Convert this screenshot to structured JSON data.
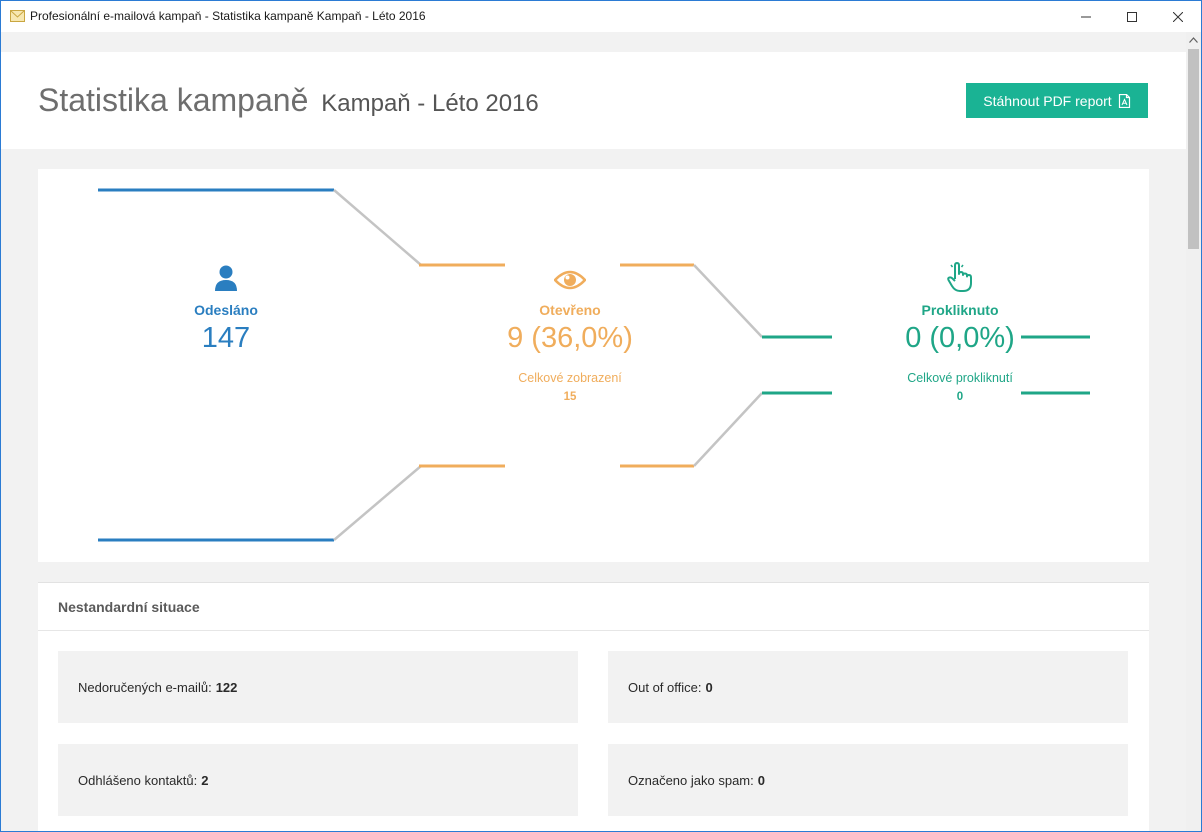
{
  "window": {
    "title": "Profesionální e-mailová kampaň - Statistika kampaně Kampaň - Léto 2016"
  },
  "header": {
    "title": "Statistika kampaně",
    "campaign_name": "Kampaň - Léto 2016",
    "pdf_button_label": "Stáhnout PDF report"
  },
  "funnel": {
    "sent": {
      "label": "Odesláno",
      "value": "147"
    },
    "opened": {
      "label": "Otevřeno",
      "value": "9 (36,0%)",
      "sub_label": "Celkové zobrazení",
      "sub_value": "15"
    },
    "clicked": {
      "label": "Prokliknuto",
      "value": "0 (0,0%)",
      "sub_label": "Celkové prokliknutí",
      "sub_value": "0"
    }
  },
  "issues": {
    "title": "Nestandardní situace",
    "items": [
      {
        "label": "Nedoručených e-mailů:",
        "value": "122"
      },
      {
        "label": "Out of office:",
        "value": "0"
      },
      {
        "label": "Odhlášeno kontaktů:",
        "value": "2"
      },
      {
        "label": "Označeno jako spam:",
        "value": "0"
      }
    ]
  },
  "colors": {
    "sent": "#2a7ec0",
    "opened": "#f0ad5c",
    "clicked": "#1fa687",
    "connector": "#c4c4c4",
    "button": "#1ab394"
  },
  "icons": {
    "sent": "user-icon",
    "opened": "eye-icon",
    "clicked": "pointer-hand-icon",
    "pdf": "pdf-file-icon"
  }
}
